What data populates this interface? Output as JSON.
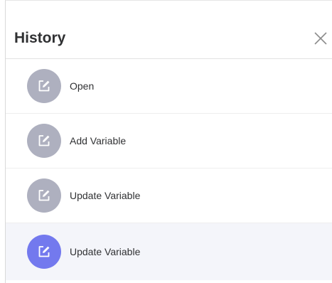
{
  "header": {
    "title": "History"
  },
  "icons": {
    "close": "close-icon",
    "entry": "edit-icon"
  },
  "colors": {
    "inactive_icon_bg": "#aeb0bf",
    "active_icon_bg": "#7379ee",
    "active_row_bg": "#f4f5fa"
  },
  "history": {
    "items": [
      {
        "label": "Open",
        "active": false
      },
      {
        "label": "Add Variable",
        "active": false
      },
      {
        "label": "Update Variable",
        "active": false
      },
      {
        "label": "Update Variable",
        "active": true
      }
    ]
  }
}
